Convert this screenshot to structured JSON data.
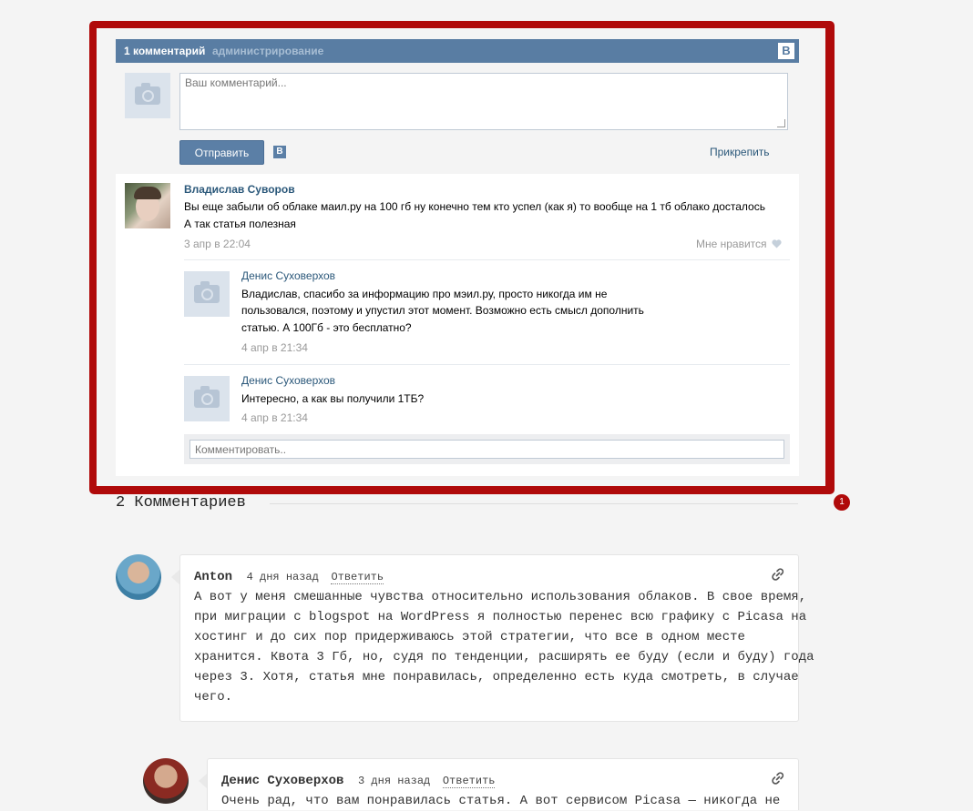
{
  "widget": {
    "header": {
      "count": "1 комментарий",
      "admin": "администрирование",
      "logo": "В"
    },
    "composer": {
      "placeholder": "Ваш комментарий...",
      "send_label": "Отправить",
      "vk_logo": "В",
      "attach_label": "Прикрепить"
    },
    "comment": {
      "author": "Владислав Суворов",
      "text1": "Вы еще забыли об облаке маил.ру на 100 гб ну конечно тем кто успел (как я) то вообще на 1 тб облако досталось",
      "text2": "А так статья полезная",
      "date": "3 апр в 22:04",
      "like_label": "Мне нравится"
    },
    "replies": [
      {
        "author": "Денис Суховерхов",
        "lines": [
          "Владислав, спасибо за информацию про мэил.ру, просто никогда им не",
          "пользовался, поэтому и упустил этот момент. Возможно есть смысл дополнить",
          "статью. А 100Гб - это бесплатно?"
        ],
        "date": "4 апр в 21:34"
      },
      {
        "author": "Денис Суховерхов",
        "lines": [
          "Интересно, а как вы получили 1ТБ?"
        ],
        "date": "4 апр в 21:34"
      }
    ],
    "reply_placeholder": "Комментировать..",
    "badge": "1"
  },
  "blog": {
    "title": "2 Комментариев",
    "comments": [
      {
        "author": "Anton",
        "time": "4 дня назад",
        "reply": "Ответить",
        "lines": [
          "А вот у меня смешанные чувства относительно использования облаков. В свое время,",
          "при миграции с blogspot на WordPress я полностью перенес всю графику с Picasa на",
          "хостинг и до сих пор придерживаюсь этой стратегии, что все в одном месте",
          "хранится. Квота 3 Гб, но, судя по тенденции, расширять ее буду (если и буду) года",
          "через 3. Хотя, статья мне понравилась, определенно есть куда смотреть, в случае",
          "чего."
        ]
      },
      {
        "author": "Денис Суховерхов",
        "time": "3 дня назад",
        "reply": "Ответить",
        "lines": [
          "Очень рад, что вам понравилась статья. А вот сервисом Picasa — никогда не"
        ]
      }
    ]
  },
  "colors": {
    "vk_blue": "#597da3",
    "frame_red": "#b00a0a",
    "link": "#2b587a"
  }
}
